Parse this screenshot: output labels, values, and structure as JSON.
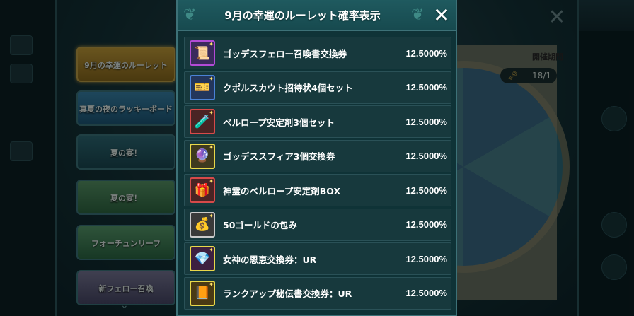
{
  "background": {
    "banners": [
      "9月の幸運のルーレット",
      "真夏の夜のラッキーボード",
      "夏の宴！",
      "夏の宴！",
      "フォーチュンリーフ",
      "新フェロー召喚"
    ],
    "key_count": "18/1",
    "status_label": "開催期間"
  },
  "modal": {
    "title": "9月の幸運のルーレット確率表示",
    "close_icon": "close-icon"
  },
  "items": [
    {
      "name": "ゴッデスフェロー召喚書交換券",
      "rate": "12.5000%",
      "icon": "scroll-ticket-icon",
      "frame": "#b24bd6",
      "fill": "#3a2a5c",
      "glyph": "📜"
    },
    {
      "name": "クポルスカウト招待状4個セット",
      "rate": "12.5000%",
      "icon": "invitation-ticket-icon",
      "frame": "#4a82d6",
      "fill": "#23365c",
      "glyph": "🎫"
    },
    {
      "name": "ベルロープ安定剤3個セット",
      "rate": "12.5000%",
      "icon": "potion-set-icon",
      "frame": "#d64a4a",
      "fill": "#4a2424",
      "glyph": "🧪"
    },
    {
      "name": "ゴッデススフィア3個交換券",
      "rate": "12.5000%",
      "icon": "sphere-ticket-icon",
      "frame": "#e8d84a",
      "fill": "#3e3a1e",
      "glyph": "🔮"
    },
    {
      "name": "神霊のベルロープ安定剤BOX",
      "rate": "12.5000%",
      "icon": "treasure-box-icon",
      "frame": "#d64a4a",
      "fill": "#4a2424",
      "glyph": "🎁"
    },
    {
      "name": "50ゴールドの包み",
      "rate": "12.5000%",
      "icon": "gold-bag-icon",
      "frame": "#c9c9c9",
      "fill": "#3a3a3a",
      "glyph": "💰"
    },
    {
      "name": "女神の恩恵交換券：UR",
      "rate": "12.5000%",
      "icon": "blessing-gem-icon",
      "frame": "#e8d84a",
      "fill": "#3e2040",
      "glyph": "💎"
    },
    {
      "name": "ランクアップ秘伝書交換券：UR",
      "rate": "12.5000%",
      "icon": "rankup-book-icon",
      "frame": "#e8d84a",
      "fill": "#4a3a14",
      "glyph": "📙"
    }
  ]
}
